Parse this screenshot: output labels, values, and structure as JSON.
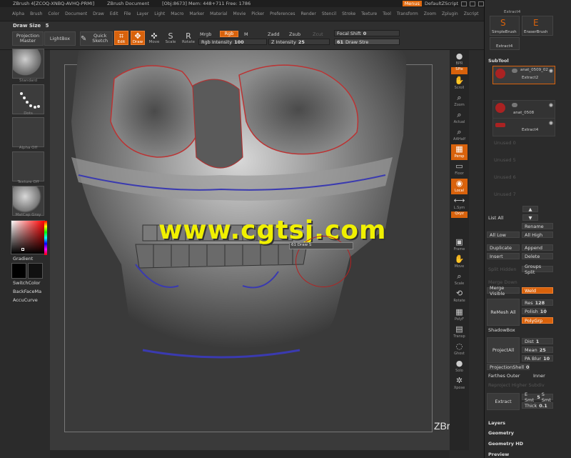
{
  "titlebar": {
    "app": "ZBrush 4[ZCOQ-XNBQ-AVHQ-PRMI]",
    "doc": "ZBrush Document",
    "stats": "[Obj:8673] Mem: 448+711 Free: 1786",
    "menus": "Menus",
    "script": "DefaultZScript"
  },
  "menubar": [
    "Alpha",
    "Brush",
    "Color",
    "Document",
    "Draw",
    "Edit",
    "File",
    "Layer",
    "Light",
    "Macro",
    "Marker",
    "Material",
    "Movie",
    "Picker",
    "Preferences",
    "Render",
    "Stencil",
    "Stroke",
    "Texture",
    "Tool",
    "Transform",
    "Zoom",
    "Zplugin",
    "Zscript"
  ],
  "shelf": {
    "draw_size_label": "Draw Size",
    "draw_size_value": "5",
    "projection_master": "Projection Master",
    "lightbox": "LightBox",
    "quick_sketch": "Quick Sketch",
    "edit": "Edit",
    "draw": "Draw",
    "move": "Move",
    "scale": "Scale",
    "rotate": "Rotate",
    "mrgb": "Mrgb",
    "rgb": "Rgb",
    "m": "M",
    "rgb_intensity_label": "Rgb Intensity",
    "rgb_intensity_value": "100",
    "zadd": "Zadd",
    "zsub": "Zsub",
    "zcut": "Zcut",
    "z_intensity_label": "Z Intensity",
    "z_intensity_value": "25",
    "focal_shift_label": "Focal Shift",
    "focal_shift_value": "0",
    "draw_strength_label": "Draw Stre",
    "draw_strength_value": "61"
  },
  "lefttray": {
    "standard": "Standard",
    "dots": "Dots",
    "alpha_off": "Alpha Off",
    "texture_off": "Texture Off",
    "matcap": "MatCap Gray",
    "gradient": "Gradient",
    "switchcolor": "SwitchColor",
    "backface": "BackFaceMa",
    "accucurve": "AccuCurve"
  },
  "canvas": {
    "watermark": "www.cgtsj.com",
    "brush_tip": "61 Draw S"
  },
  "righticons": {
    "bpr": "BPR",
    "spix": "SPix",
    "scroll": "Scroll",
    "zoom": "Zoom",
    "actual": "Actual",
    "aahalf": "AAHalf",
    "persp": "Persp",
    "floor": "Floor",
    "local": "Local",
    "lsym": "L.Sym",
    "xyz": "Qxyz",
    "frame": "Frame",
    "move": "Move",
    "scale": "Scale",
    "rotate": "Rotate",
    "polyf": "PolyF",
    "transp": "Transp",
    "ghost": "Ghost",
    "solo": "Solo",
    "xpose": "Xpose"
  },
  "palette": {
    "extract4_top": "Extract4",
    "simplebrush": "SimpleBrush",
    "eraserbrush": "EraserBrush",
    "extract4_mid": "Extract4",
    "subtool_header": "SubTool",
    "subtools": [
      {
        "name": "Extract2",
        "label": "anat_0509_02"
      },
      {
        "name": "anat_0508",
        "label": ""
      },
      {
        "name": "Extract4",
        "label": ""
      }
    ],
    "unused": [
      "Unused 0",
      "Unused 5",
      "Unused 6",
      "Unused 7"
    ],
    "list_all": "List All",
    "rename": "Rename",
    "all_low": "All Low",
    "all_high": "All High",
    "duplicate": "Duplicate",
    "append": "Append",
    "insert": "Insert",
    "delete": "Delete",
    "split_hidden": "Split Hidden",
    "groups_split": "Groups Split",
    "merge_down": "Merge Down",
    "merge_visible": "Merge Visible",
    "weld": "Weld",
    "res_label": "Res",
    "res_value": "128",
    "remesh_all": "ReMesh All",
    "polish_label": "Polish",
    "polish_value": "10",
    "polygrp": "PolyGrp",
    "shadowbox": "ShadowBox",
    "dist_label": "Dist",
    "dist_value": "1",
    "projectall": "ProjectAll",
    "mean_label": "Mean",
    "mean_value": "25",
    "pa_blur_label": "PA Blur",
    "pa_blur_value": "10",
    "projectionshell_label": "ProjectionShell",
    "projectionshell_value": "0",
    "farthest": "Farthes Outer",
    "inner": "Inner",
    "reproject": "Reproject Higher Subdiv",
    "extract": "Extract",
    "e_smt": "E Smt",
    "e_smt_value": "5",
    "s_smt": "S Smt",
    "thick_label": "Thick",
    "thick_value": "0.1",
    "layers": "Layers",
    "geometry": "Geometry",
    "geometry_hd": "Geometry HD",
    "preview": "Preview"
  },
  "brand": "ZBrushWorkshops"
}
